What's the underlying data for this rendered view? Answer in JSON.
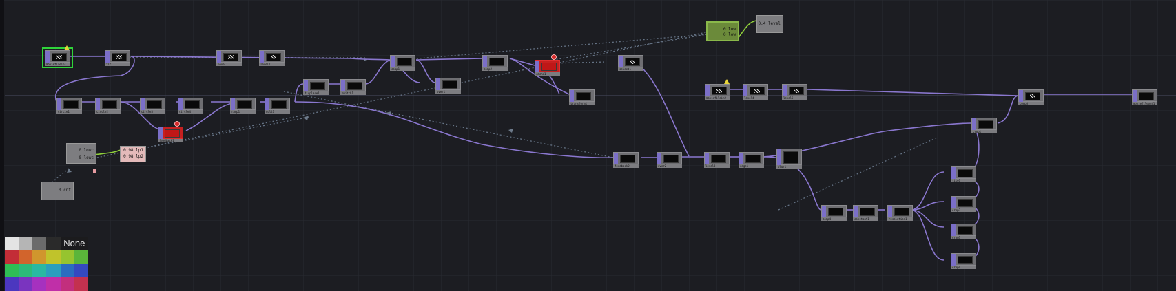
{
  "editor": {
    "background": "#1c1d22",
    "grid_color": "#2c2d35",
    "wire_color": "#8a77cf",
    "dotted_wire_color": "#6d7a8a"
  },
  "nodes": [
    {
      "id": "moviefilein1",
      "label": "moviefilein1",
      "kind": "noise",
      "state": "selected-warning"
    },
    {
      "id": "fit1",
      "label": "fit1",
      "kind": "noise"
    },
    {
      "id": "level1",
      "label": "level1",
      "kind": "noise"
    },
    {
      "id": "level2",
      "label": "level2",
      "kind": "noise"
    },
    {
      "id": "comp1",
      "label": "comp1",
      "kind": "dark"
    },
    {
      "id": "comp2",
      "label": "comp2",
      "kind": "dark"
    },
    {
      "id": "cache1",
      "label": "cache1",
      "kind": "error"
    },
    {
      "id": "select1",
      "label": "select1",
      "kind": "noise"
    },
    {
      "id": "over1",
      "label": "over1",
      "kind": "dark"
    },
    {
      "id": "transform1",
      "label": "transform1",
      "kind": "dark"
    },
    {
      "id": "switch1",
      "label": "switch1",
      "kind": "dark"
    },
    {
      "id": "displace1",
      "label": "displace1",
      "kind": "dark"
    },
    {
      "id": "circle1",
      "label": "circle1",
      "kind": "dark"
    },
    {
      "id": "circle2",
      "label": "circle2",
      "kind": "dark"
    },
    {
      "id": "circle3",
      "label": "circle3",
      "kind": "dark"
    },
    {
      "id": "circle4",
      "label": "circle4",
      "kind": "dark"
    },
    {
      "id": "ramp1",
      "label": "ramp1",
      "kind": "dark"
    },
    {
      "id": "null1",
      "label": "null1",
      "kind": "dark"
    },
    {
      "id": "feedback1",
      "label": "feedback1",
      "kind": "error"
    },
    {
      "id": "feedback2",
      "label": "feedback2",
      "kind": "dark"
    },
    {
      "id": "over2",
      "label": "over2",
      "kind": "dark"
    },
    {
      "id": "level3",
      "label": "level3",
      "kind": "dark"
    },
    {
      "id": "edge1",
      "label": "edge1",
      "kind": "dark"
    },
    {
      "id": "blur1",
      "label": "blur1",
      "kind": "dark"
    },
    {
      "id": "crop1",
      "label": "crop1",
      "kind": "dark"
    },
    {
      "id": "movefilein2",
      "label": "moviefilein2",
      "kind": "noise",
      "state": "warning"
    },
    {
      "id": "level4",
      "label": "level4",
      "kind": "noise"
    },
    {
      "id": "level5",
      "label": "level5",
      "kind": "noise"
    },
    {
      "id": "comp3",
      "label": "comp3",
      "kind": "noise"
    },
    {
      "id": "moviefileout1",
      "label": "moviefileout1",
      "kind": "dark"
    },
    {
      "id": "comp4",
      "label": "comp4",
      "kind": "dark"
    },
    {
      "id": "constant1",
      "label": "constant1",
      "kind": "dark"
    },
    {
      "id": "resolution1",
      "label": "resolution1",
      "kind": "dark"
    },
    {
      "id": "tile1",
      "label": "tile1",
      "kind": "dark"
    },
    {
      "id": "crop2",
      "label": "crop2",
      "kind": "dark"
    },
    {
      "id": "crop3",
      "label": "crop3",
      "kind": "dark"
    },
    {
      "id": "crop4",
      "label": "crop4",
      "kind": "dark"
    },
    {
      "id": "crop5",
      "label": "crop5",
      "kind": "dark"
    }
  ],
  "value_nodes": [
    {
      "id": "audiospectrum1",
      "label": "audiospectrum1",
      "lines": [
        "0 low",
        "0 low"
      ],
      "color": "green"
    },
    {
      "id": "math1",
      "label": "math1",
      "lines": [
        "0.4 level"
      ]
    },
    {
      "id": "lfo1",
      "label": "lfo1",
      "lines": [
        "0 lowc",
        "0 lowc"
      ]
    },
    {
      "id": "null2",
      "label": "null2",
      "lines": [
        "0.98 lp1",
        "0.98 lp2"
      ]
    },
    {
      "id": "timecode1",
      "label": "timecode1",
      "lines": [
        "0 cnt"
      ]
    }
  ],
  "swatches": {
    "rows": [
      [
        "#e4e4e4",
        "#b5b5b5",
        "#6b6b6b",
        "#2a2a2a"
      ],
      [
        "#c32d37",
        "#d2642c",
        "#d0962d",
        "#c0c32b",
        "#96c42f",
        "#5ab53a"
      ],
      [
        "#2fbe55",
        "#2dba7a",
        "#2ab8a2",
        "#2a9fbe",
        "#2a6dc0",
        "#3449c0"
      ],
      [
        "#4b37bf",
        "#7a34bf",
        "#a631bf",
        "#c02fa8",
        "#c22f7d",
        "#c3314f"
      ]
    ],
    "none_label": "None"
  }
}
